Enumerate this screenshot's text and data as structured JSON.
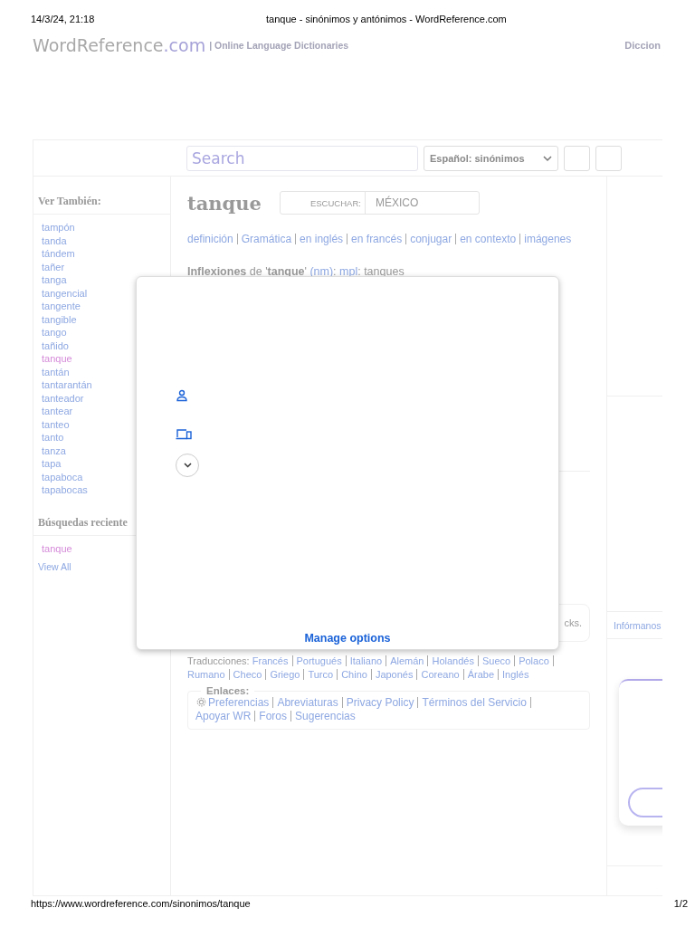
{
  "print_header": {
    "date": "14/3/24, 21:18",
    "title": "tanque - sinónimos y antónimos - WordReference.com"
  },
  "site_header": {
    "logo_name": "WordReference",
    "logo_tld": ".com",
    "tagline": "| Online Language Dictionaries",
    "nav_item": "Diccion"
  },
  "toolbar": {
    "search": {
      "placeholder": "Search"
    },
    "dictionary_select": {
      "value": "Español: sinónimos"
    }
  },
  "sidebar": {
    "see_also": {
      "heading": "Ver También:",
      "items": [
        {
          "label": "tampón",
          "visited": false
        },
        {
          "label": "tanda",
          "visited": false
        },
        {
          "label": "tándem",
          "visited": false
        },
        {
          "label": "tañer",
          "visited": false
        },
        {
          "label": "tanga",
          "visited": false
        },
        {
          "label": "tangencial",
          "visited": false
        },
        {
          "label": "tangente",
          "visited": false
        },
        {
          "label": "tangible",
          "visited": false
        },
        {
          "label": "tango",
          "visited": false
        },
        {
          "label": "tañido",
          "visited": false
        },
        {
          "label": "tanque",
          "visited": true
        },
        {
          "label": "tantán",
          "visited": false
        },
        {
          "label": "tantarantán",
          "visited": false
        },
        {
          "label": "tanteador",
          "visited": false
        },
        {
          "label": "tantear",
          "visited": false
        },
        {
          "label": "tanteo",
          "visited": false
        },
        {
          "label": "tanto",
          "visited": false
        },
        {
          "label": "tanza",
          "visited": false
        },
        {
          "label": "tapa",
          "visited": false
        },
        {
          "label": "tapaboca",
          "visited": false
        },
        {
          "label": "tapabocas",
          "visited": false
        }
      ]
    },
    "recent": {
      "heading": "Búsquedas reciente",
      "items": [
        {
          "label": "tanque",
          "visited": true
        }
      ],
      "view_all": "View All"
    }
  },
  "entry": {
    "headword": "tanque",
    "listen": {
      "label": "ESCUCHAR:",
      "value": "MÉXICO"
    },
    "links": [
      "definición",
      "Gramática",
      "en inglés",
      "en francés",
      "conjugar",
      "en contexto",
      "imágenes"
    ],
    "inflections": [
      {
        "kind": "text",
        "text": "**Inflexiones** de '**tanque**' "
      },
      {
        "kind": "link",
        "text": "(nm)"
      },
      {
        "kind": "text",
        "text": ": "
      },
      {
        "kind": "link",
        "text": "mpl"
      },
      {
        "kind": "text",
        "text": ": tanques"
      }
    ]
  },
  "hidden_card": {
    "text": "cks."
  },
  "translations": {
    "label": "Traducciones:",
    "links": [
      "Francés",
      "Portugués",
      "Italiano",
      "Alemán",
      "Holandés",
      "Sueco",
      "Polaco",
      "Rumano",
      "Checo",
      "Griego",
      "Turco",
      "Chino",
      "Japonés",
      "Coreano",
      "Árabe",
      "Inglés"
    ]
  },
  "links_box": {
    "legend": "Enlaces:",
    "links": [
      "Preferencias",
      "Abreviaturas",
      "Privacy Policy",
      "Términos del Servicio",
      "Apoyar WR",
      "Foros",
      "Sugerencias"
    ]
  },
  "right_column": {
    "report_link": "Infórmanos"
  },
  "consent_dialog": {
    "manage_button": "Manage options"
  },
  "print_footer": {
    "url": "https://www.wordreference.com/sinonimos/tanque",
    "page": "1/2"
  }
}
